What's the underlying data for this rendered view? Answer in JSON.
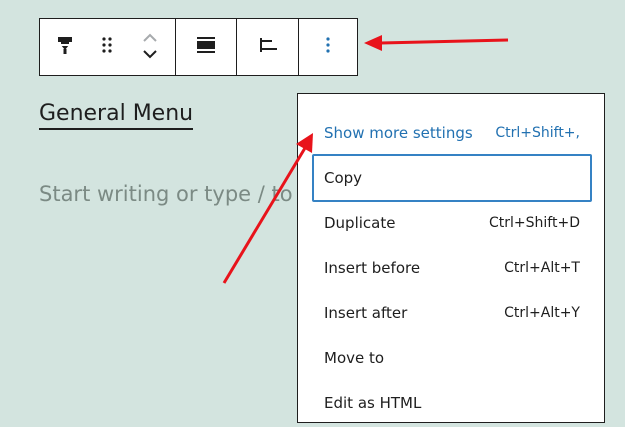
{
  "toolbar": {
    "icons": {
      "block_type": "navigation-icon",
      "drag": "drag-handle-icon",
      "move_up": "chevron-up-icon",
      "move_down": "chevron-down-icon",
      "align": "align-center-icon",
      "justify": "justify-left-icon",
      "options": "more-vertical-icon"
    }
  },
  "block": {
    "title": "General Menu",
    "placeholder": "Start writing or type / to"
  },
  "menu": {
    "items": [
      {
        "label": "Show more settings",
        "shortcut": "Ctrl+Shift+,"
      },
      {
        "label": "Copy",
        "shortcut": ""
      },
      {
        "label": "Duplicate",
        "shortcut": "Ctrl+Shift+D"
      },
      {
        "label": "Insert before",
        "shortcut": "Ctrl+Alt+T"
      },
      {
        "label": "Insert after",
        "shortcut": "Ctrl+Alt+Y"
      },
      {
        "label": "Move to",
        "shortcut": ""
      },
      {
        "label": "Edit as HTML",
        "shortcut": ""
      }
    ]
  },
  "colors": {
    "background": "#d3e4df",
    "accent": "#2271b1",
    "focus_ring": "#3582c4",
    "annotation_arrow": "#e8131b"
  }
}
